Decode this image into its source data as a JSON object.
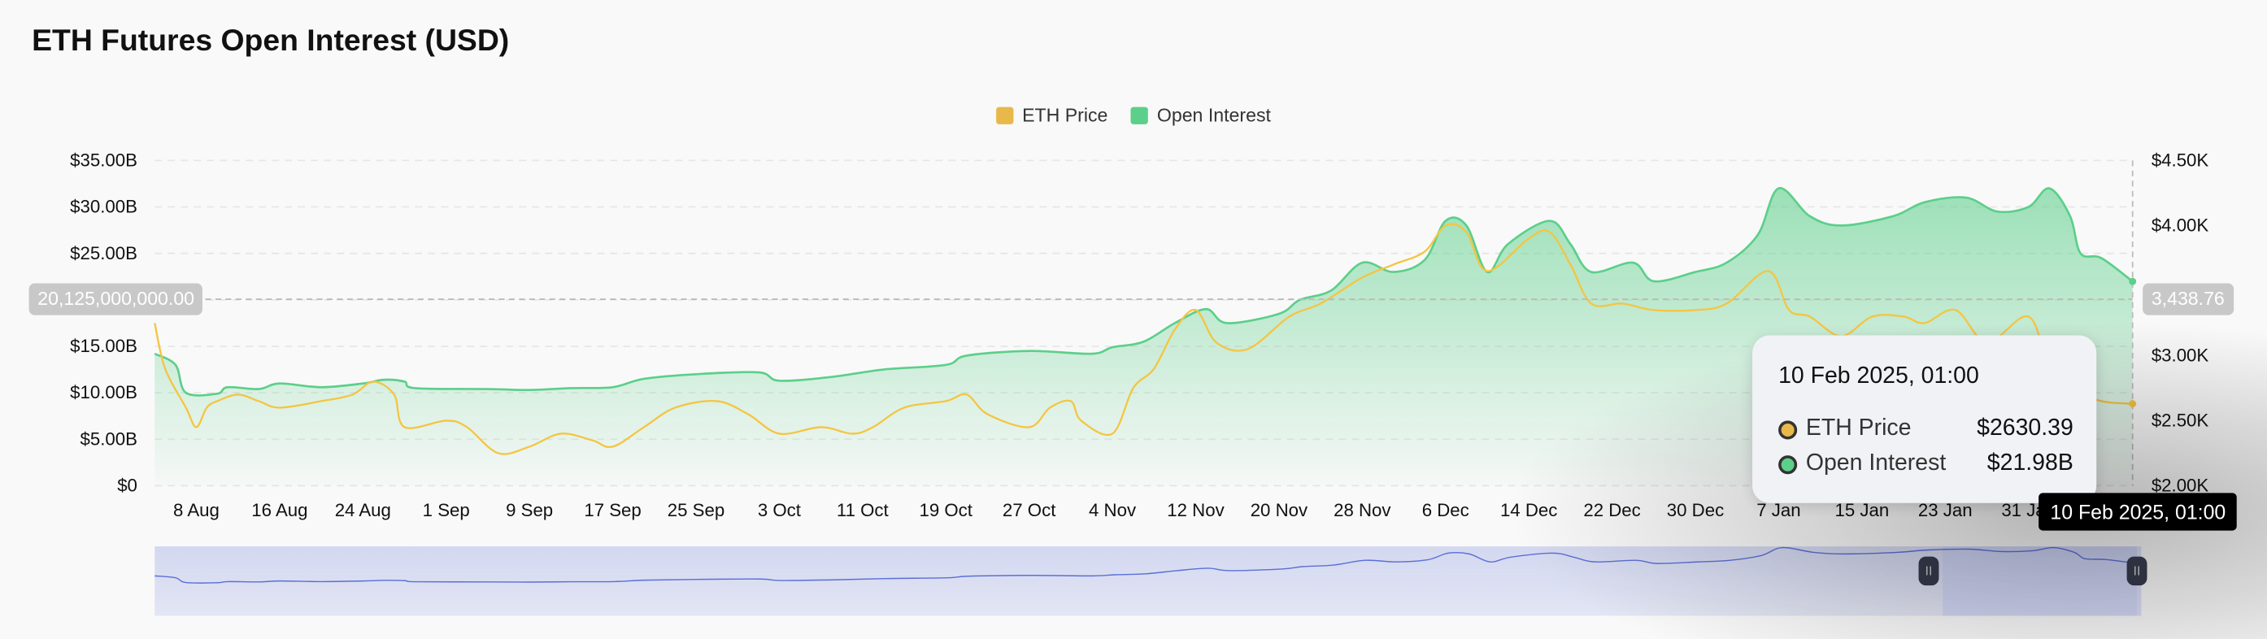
{
  "title": "ETH Futures Open Interest (USD)",
  "colors": {
    "eth_price": "#f4c542",
    "open_interest": "#5ccf8a",
    "navigator": "#5b6fd6"
  },
  "legend": [
    {
      "label": "ETH Price",
      "color": "#e8b84a"
    },
    {
      "label": "Open Interest",
      "color": "#5ccf8a"
    }
  ],
  "crosshair": {
    "left_value": "20,125,000,000.00",
    "right_value": "3,438.76",
    "x_label": "10 Feb 2025, 01:00"
  },
  "tooltip": {
    "date": "10 Feb 2025, 01:00",
    "rows": [
      {
        "label": "ETH Price",
        "value": "$2630.39"
      },
      {
        "label": "Open Interest",
        "value": "$21.98B"
      }
    ]
  },
  "chart_data": {
    "type": "area",
    "x_range": [
      "2024-08-04",
      "2025-02-10"
    ],
    "x_ticks": [
      "8 Aug",
      "16 Aug",
      "24 Aug",
      "1 Sep",
      "9 Sep",
      "17 Sep",
      "25 Sep",
      "3 Oct",
      "11 Oct",
      "19 Oct",
      "27 Oct",
      "4 Nov",
      "12 Nov",
      "20 Nov",
      "28 Nov",
      "6 Dec",
      "14 Dec",
      "22 Dec",
      "30 Dec",
      "7 Jan",
      "15 Jan",
      "23 Jan",
      "31 Jan"
    ],
    "x_tick_dates": [
      "2024-08-08",
      "2024-08-16",
      "2024-08-24",
      "2024-09-01",
      "2024-09-09",
      "2024-09-17",
      "2024-09-25",
      "2024-10-03",
      "2024-10-11",
      "2024-10-19",
      "2024-10-27",
      "2024-11-04",
      "2024-11-12",
      "2024-11-20",
      "2024-11-28",
      "2024-12-06",
      "2024-12-14",
      "2024-12-22",
      "2024-12-30",
      "2025-01-07",
      "2025-01-15",
      "2025-01-23",
      "2025-01-31"
    ],
    "y_left": {
      "ticks": [
        "$0",
        "$5.00B",
        "$10.00B",
        "$15.00B",
        "$20.00B",
        "$25.00B",
        "$30.00B",
        "$35.00B"
      ],
      "range": [
        0,
        35
      ],
      "unit": "B USD"
    },
    "y_right": {
      "ticks": [
        "$2.00K",
        "$2.50K",
        "$3.00K",
        "$3.50K",
        "$4.00K",
        "$4.50K"
      ],
      "range": [
        2.0,
        4.5
      ],
      "unit": "K USD"
    },
    "grid": true,
    "legend_position": "top-center",
    "series": [
      {
        "name": "Open Interest",
        "axis": "left",
        "points": [
          [
            "2024-08-04",
            14.2
          ],
          [
            "2024-08-06",
            13
          ],
          [
            "2024-08-07",
            10
          ],
          [
            "2024-08-10",
            9.9
          ],
          [
            "2024-08-11",
            10.6
          ],
          [
            "2024-08-14",
            10.4
          ],
          [
            "2024-08-16",
            11
          ],
          [
            "2024-08-20",
            10.6
          ],
          [
            "2024-08-24",
            11
          ],
          [
            "2024-08-26",
            11.4
          ],
          [
            "2024-08-28",
            11.2
          ],
          [
            "2024-08-29",
            10.5
          ],
          [
            "2024-09-05",
            10.4
          ],
          [
            "2024-09-09",
            10.3
          ],
          [
            "2024-09-13",
            10.5
          ],
          [
            "2024-09-17",
            10.6
          ],
          [
            "2024-09-20",
            11.5
          ],
          [
            "2024-09-25",
            12
          ],
          [
            "2024-10-01",
            12.2
          ],
          [
            "2024-10-03",
            11.3
          ],
          [
            "2024-10-08",
            11.7
          ],
          [
            "2024-10-13",
            12.5
          ],
          [
            "2024-10-19",
            13
          ],
          [
            "2024-10-21",
            14
          ],
          [
            "2024-10-27",
            14.5
          ],
          [
            "2024-11-02",
            14.2
          ],
          [
            "2024-11-04",
            14.9
          ],
          [
            "2024-11-07",
            15.5
          ],
          [
            "2024-11-10",
            17.5
          ],
          [
            "2024-11-13",
            19
          ],
          [
            "2024-11-15",
            17.5
          ],
          [
            "2024-11-20",
            18.5
          ],
          [
            "2024-11-22",
            20
          ],
          [
            "2024-11-25",
            21
          ],
          [
            "2024-11-28",
            24
          ],
          [
            "2024-12-01",
            23
          ],
          [
            "2024-12-04",
            24.3
          ],
          [
            "2024-12-06",
            28.5
          ],
          [
            "2024-12-08",
            28
          ],
          [
            "2024-12-10",
            23
          ],
          [
            "2024-12-12",
            26
          ],
          [
            "2024-12-16",
            28.5
          ],
          [
            "2024-12-18",
            26
          ],
          [
            "2024-12-20",
            23
          ],
          [
            "2024-12-24",
            24
          ],
          [
            "2024-12-26",
            22
          ],
          [
            "2024-12-30",
            23
          ],
          [
            "2025-01-02",
            24
          ],
          [
            "2025-01-05",
            27
          ],
          [
            "2025-01-07",
            32
          ],
          [
            "2025-01-10",
            29
          ],
          [
            "2025-01-13",
            28
          ],
          [
            "2025-01-18",
            29
          ],
          [
            "2025-01-21",
            30.5
          ],
          [
            "2025-01-25",
            31
          ],
          [
            "2025-01-28",
            29.5
          ],
          [
            "2025-01-31",
            30
          ],
          [
            "2025-02-02",
            32
          ],
          [
            "2025-02-04",
            29
          ],
          [
            "2025-02-05",
            25
          ],
          [
            "2025-02-07",
            24.5
          ],
          [
            "2025-02-10",
            21.98
          ]
        ]
      },
      {
        "name": "ETH Price",
        "axis": "right",
        "points": [
          [
            "2024-08-04",
            3.25
          ],
          [
            "2024-08-05",
            2.9
          ],
          [
            "2024-08-07",
            2.6
          ],
          [
            "2024-08-08",
            2.45
          ],
          [
            "2024-08-09",
            2.6
          ],
          [
            "2024-08-10",
            2.65
          ],
          [
            "2024-08-12",
            2.7
          ],
          [
            "2024-08-14",
            2.65
          ],
          [
            "2024-08-16",
            2.6
          ],
          [
            "2024-08-20",
            2.65
          ],
          [
            "2024-08-23",
            2.7
          ],
          [
            "2024-08-25",
            2.8
          ],
          [
            "2024-08-27",
            2.7
          ],
          [
            "2024-08-28",
            2.45
          ],
          [
            "2024-09-01",
            2.5
          ],
          [
            "2024-09-03",
            2.45
          ],
          [
            "2024-09-06",
            2.25
          ],
          [
            "2024-09-09",
            2.3
          ],
          [
            "2024-09-12",
            2.4
          ],
          [
            "2024-09-15",
            2.35
          ],
          [
            "2024-09-17",
            2.3
          ],
          [
            "2024-09-20",
            2.45
          ],
          [
            "2024-09-23",
            2.6
          ],
          [
            "2024-09-27",
            2.65
          ],
          [
            "2024-09-30",
            2.55
          ],
          [
            "2024-10-03",
            2.4
          ],
          [
            "2024-10-07",
            2.45
          ],
          [
            "2024-10-10",
            2.4
          ],
          [
            "2024-10-12",
            2.45
          ],
          [
            "2024-10-15",
            2.6
          ],
          [
            "2024-10-19",
            2.65
          ],
          [
            "2024-10-21",
            2.7
          ],
          [
            "2024-10-23",
            2.55
          ],
          [
            "2024-10-27",
            2.45
          ],
          [
            "2024-10-29",
            2.6
          ],
          [
            "2024-10-31",
            2.65
          ],
          [
            "2024-11-01",
            2.5
          ],
          [
            "2024-11-04",
            2.4
          ],
          [
            "2024-11-06",
            2.75
          ],
          [
            "2024-11-08",
            2.9
          ],
          [
            "2024-11-10",
            3.2
          ],
          [
            "2024-11-12",
            3.35
          ],
          [
            "2024-11-14",
            3.1
          ],
          [
            "2024-11-17",
            3.05
          ],
          [
            "2024-11-21",
            3.3
          ],
          [
            "2024-11-24",
            3.4
          ],
          [
            "2024-11-28",
            3.6
          ],
          [
            "2024-12-01",
            3.7
          ],
          [
            "2024-12-04",
            3.8
          ],
          [
            "2024-12-06",
            4.0
          ],
          [
            "2024-12-08",
            3.95
          ],
          [
            "2024-12-10",
            3.65
          ],
          [
            "2024-12-14",
            3.9
          ],
          [
            "2024-12-16",
            3.95
          ],
          [
            "2024-12-18",
            3.7
          ],
          [
            "2024-12-20",
            3.4
          ],
          [
            "2024-12-23",
            3.4
          ],
          [
            "2024-12-26",
            3.35
          ],
          [
            "2024-12-30",
            3.35
          ],
          [
            "2025-01-02",
            3.4
          ],
          [
            "2025-01-06",
            3.65
          ],
          [
            "2025-01-08",
            3.35
          ],
          [
            "2025-01-10",
            3.3
          ],
          [
            "2025-01-13",
            3.15
          ],
          [
            "2025-01-16",
            3.3
          ],
          [
            "2025-01-19",
            3.3
          ],
          [
            "2025-01-21",
            3.25
          ],
          [
            "2025-01-24",
            3.35
          ],
          [
            "2025-01-27",
            3.1
          ],
          [
            "2025-01-31",
            3.3
          ],
          [
            "2025-02-02",
            2.9
          ],
          [
            "2025-02-04",
            2.75
          ],
          [
            "2025-02-07",
            2.65
          ],
          [
            "2025-02-10",
            2.63
          ]
        ]
      }
    ],
    "navigator": {
      "selected_range": [
        "2025-01-21",
        "2025-02-10"
      ]
    }
  }
}
